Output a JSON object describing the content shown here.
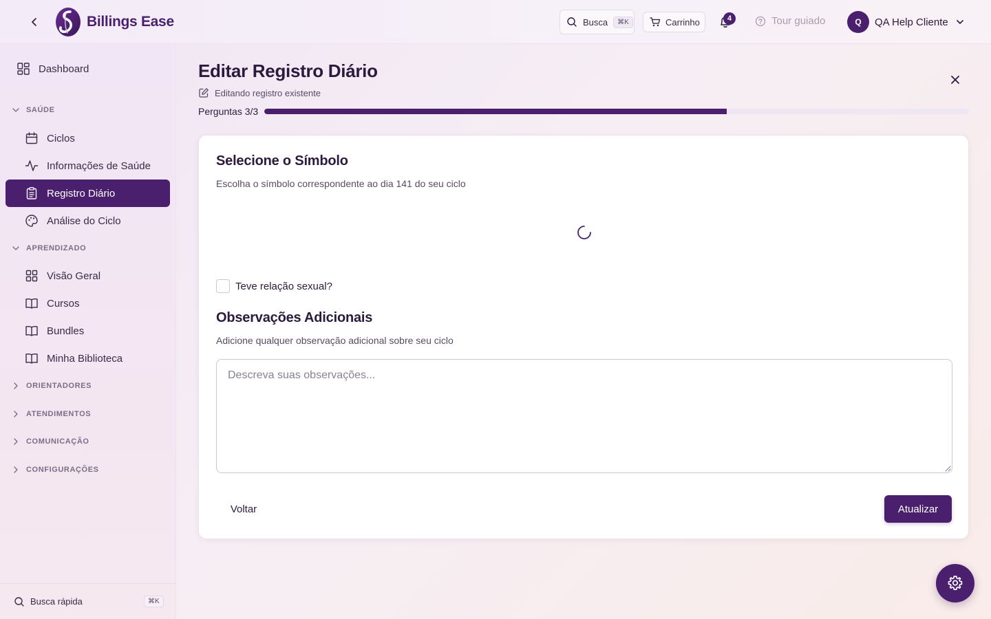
{
  "brand": {
    "name": "Billings Ease",
    "primary_color": "#4a1f6d"
  },
  "header": {
    "search": {
      "label": "Busca",
      "shortcut": "⌘K"
    },
    "cart": {
      "label": "Carrinho"
    },
    "notifications": {
      "count": "4"
    },
    "tour": {
      "label": "Tour guiado"
    },
    "user": {
      "initial": "Q",
      "name": "QA Help Cliente"
    }
  },
  "sidebar": {
    "dashboard": "Dashboard",
    "sections": {
      "saude": "SAÚDE",
      "aprendizado": "APRENDIZADO",
      "orientadores": "ORIENTADORES",
      "atendimentos": "ATENDIMENTOS",
      "comunicacao": "COMUNICAÇÃO",
      "configuracoes": "CONFIGURAÇÕES"
    },
    "saude_items": [
      "Ciclos",
      "Informações de Saúde",
      "Registro Diário",
      "Análise do Ciclo"
    ],
    "aprendizado_items": [
      "Visão Geral",
      "Cursos",
      "Bundles",
      "Minha Biblioteca"
    ],
    "active_item": "Registro Diário",
    "footer": {
      "label": "Busca rápida",
      "shortcut": "⌘K"
    }
  },
  "page": {
    "title": "Editar Registro Diário",
    "subtitle": "Editando registro existente",
    "progress": {
      "label": "Perguntas 3/3",
      "fraction": 0.656
    }
  },
  "form": {
    "symbol": {
      "title": "Selecione o Símbolo",
      "description": "Escolha o símbolo correspondente ao dia 141 do seu ciclo"
    },
    "sexual_relation": {
      "label": "Teve relação sexual?",
      "checked": false
    },
    "notes": {
      "title": "Observações Adicionais",
      "description": "Adicione qualquer observação adicional sobre seu ciclo",
      "value": "",
      "placeholder": "Descreva suas observações..."
    },
    "back_label": "Voltar",
    "submit_label": "Atualizar"
  }
}
